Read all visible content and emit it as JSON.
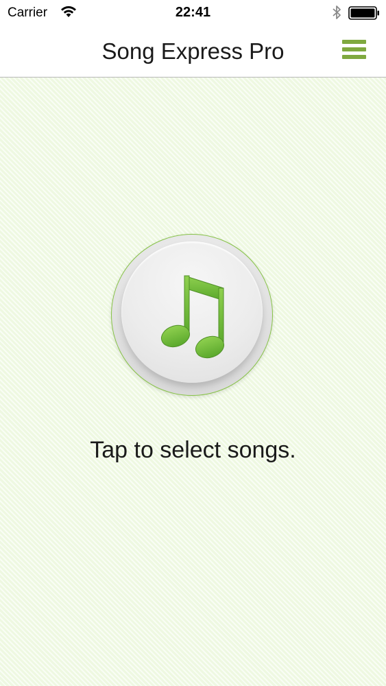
{
  "status_bar": {
    "carrier": "Carrier",
    "time": "22:41",
    "icons": [
      "wifi-icon",
      "bluetooth-icon",
      "battery-icon"
    ]
  },
  "nav": {
    "title": "Song Express Pro",
    "menu_icon": "hamburger-menu-icon"
  },
  "main": {
    "button_icon": "music-note-icon",
    "prompt": "Tap to select songs."
  },
  "colors": {
    "accent": "#7fa93f",
    "note_green": "#6cb83a",
    "background": "#f2fbe8"
  }
}
